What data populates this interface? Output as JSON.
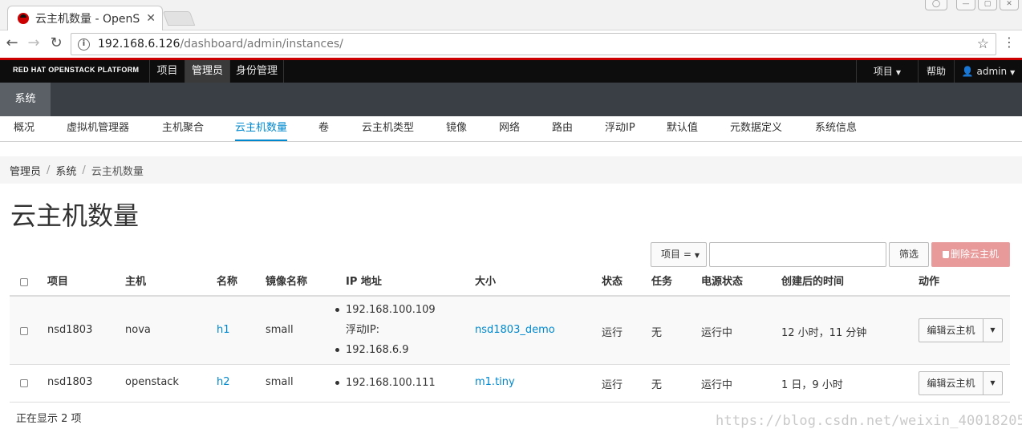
{
  "browser": {
    "tab_title": "云主机数量 - OpenS",
    "url_host": "192.168.6.126",
    "url_path": "/dashboard/admin/instances/"
  },
  "header": {
    "brand": "RED HAT OPENSTACK PLATFORM",
    "nav": [
      "项目",
      "管理员",
      "身份管理"
    ],
    "active_nav": "管理员",
    "right": {
      "project": "项目",
      "help": "帮助",
      "user": "admin"
    },
    "accent_color": "#cc0000"
  },
  "secondary_nav": {
    "active": "系统"
  },
  "tertiary_nav": {
    "items": [
      "概况",
      "虚拟机管理器",
      "主机聚合",
      "云主机数量",
      "卷",
      "云主机类型",
      "镜像",
      "网络",
      "路由",
      "浮动IP",
      "默认值",
      "元数据定义",
      "系统信息"
    ],
    "active": "云主机数量",
    "active_color": "#0088ce"
  },
  "breadcrumb": [
    "管理员",
    "系统",
    "云主机数量"
  ],
  "page_title": "云主机数量",
  "toolbar": {
    "filter_select": "项目 =",
    "filter_value": "",
    "filter_button": "筛选",
    "delete_button": "删除云主机"
  },
  "table": {
    "columns": [
      "项目",
      "主机",
      "名称",
      "镜像名称",
      "IP 地址",
      "大小",
      "状态",
      "任务",
      "电源状态",
      "创建后的时间",
      "动作"
    ],
    "rows": [
      {
        "project": "nsd1803",
        "host": "nova",
        "name": "h1",
        "image": "small",
        "ip": [
          "192.168.100.109"
        ],
        "floating_label": "浮动IP:",
        "floating_ip": [
          "192.168.6.9"
        ],
        "size": "nsd1803_demo",
        "status": "运行",
        "task": "无",
        "power": "运行中",
        "age": "12 小时，11 分钟",
        "action": "编辑云主机"
      },
      {
        "project": "nsd1803",
        "host": "openstack",
        "name": "h2",
        "image": "small",
        "ip": [
          "192.168.100.111"
        ],
        "size": "m1.tiny",
        "status": "运行",
        "task": "无",
        "power": "运行中",
        "age": "1 日，9 小时",
        "action": "编辑云主机"
      }
    ]
  },
  "footer": {
    "count": "正在显示 2 项"
  },
  "watermark": "https://blog.csdn.net/weixin_40018205"
}
